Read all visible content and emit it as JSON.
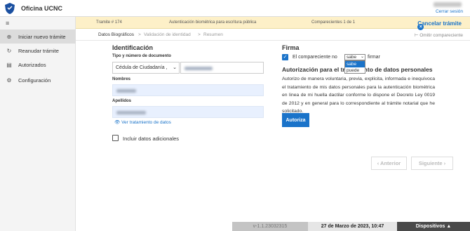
{
  "header": {
    "app_title": "Oficina UCNC",
    "logout": "Cerrar sesión"
  },
  "sidebar": {
    "items": [
      {
        "label": "Iniciar nuevo trámite",
        "icon": "plus-circle-icon",
        "active": true
      },
      {
        "label": "Reanudar trámite",
        "icon": "refresh-icon",
        "active": false
      },
      {
        "label": "Autorizados",
        "icon": "document-icon",
        "active": false
      },
      {
        "label": "Configuración",
        "icon": "gear-icon",
        "active": false
      }
    ]
  },
  "banner": {
    "tramite": "Tramite # 174",
    "description": "Autenticación biométrica para escritura pública",
    "comparecientes": "Comparecientes 1 de 1",
    "cancel": "Cancelar trámite",
    "color": "#fdf0c8"
  },
  "steps": {
    "items": [
      "Datos Biográficos",
      "Validación de identidad",
      "Resumen"
    ],
    "separator": ">",
    "skip": "Omitir compareciente"
  },
  "identificacion": {
    "title": "Identificación",
    "doc_label": "Tipo y número de documento",
    "doc_type": "Cédula de Ciudadanía ,",
    "nombres_label": "Nombres",
    "apellidos_label": "Apellidos",
    "ver_datos": "Ver tratamiento de datos",
    "adicionales": "Incluir datos adicionales"
  },
  "firma": {
    "title": "Firma",
    "label_pre": "El compareciente no",
    "selected": "sabe",
    "options": [
      "sabe",
      "puede"
    ],
    "label_post": "firmar"
  },
  "autorizacion": {
    "title": "Autorización para el tratamiento de datos personales",
    "text": "Autorizo de manera voluntaria, previa, explícita, informada e inequívoca el tratamiento de mis datos personales para la autenticación biométrica en linea de mi huella dactilar conforme lo dispone el Decreto Ley 0019 de 2012 y en general para lo correspondiente al trámite notarial que he solicitado.",
    "button": "Autoriza"
  },
  "navigation": {
    "prev": "‹ Anterior",
    "next": "Siguiente ›"
  },
  "footer": {
    "version": "v-1.1.23032315",
    "date": "27 de Marzo de 2023, 10:47",
    "devices": "Dispositivos ▲"
  },
  "colors": {
    "accent": "#1a73c9",
    "footer_dark": "#4a4a4a"
  }
}
